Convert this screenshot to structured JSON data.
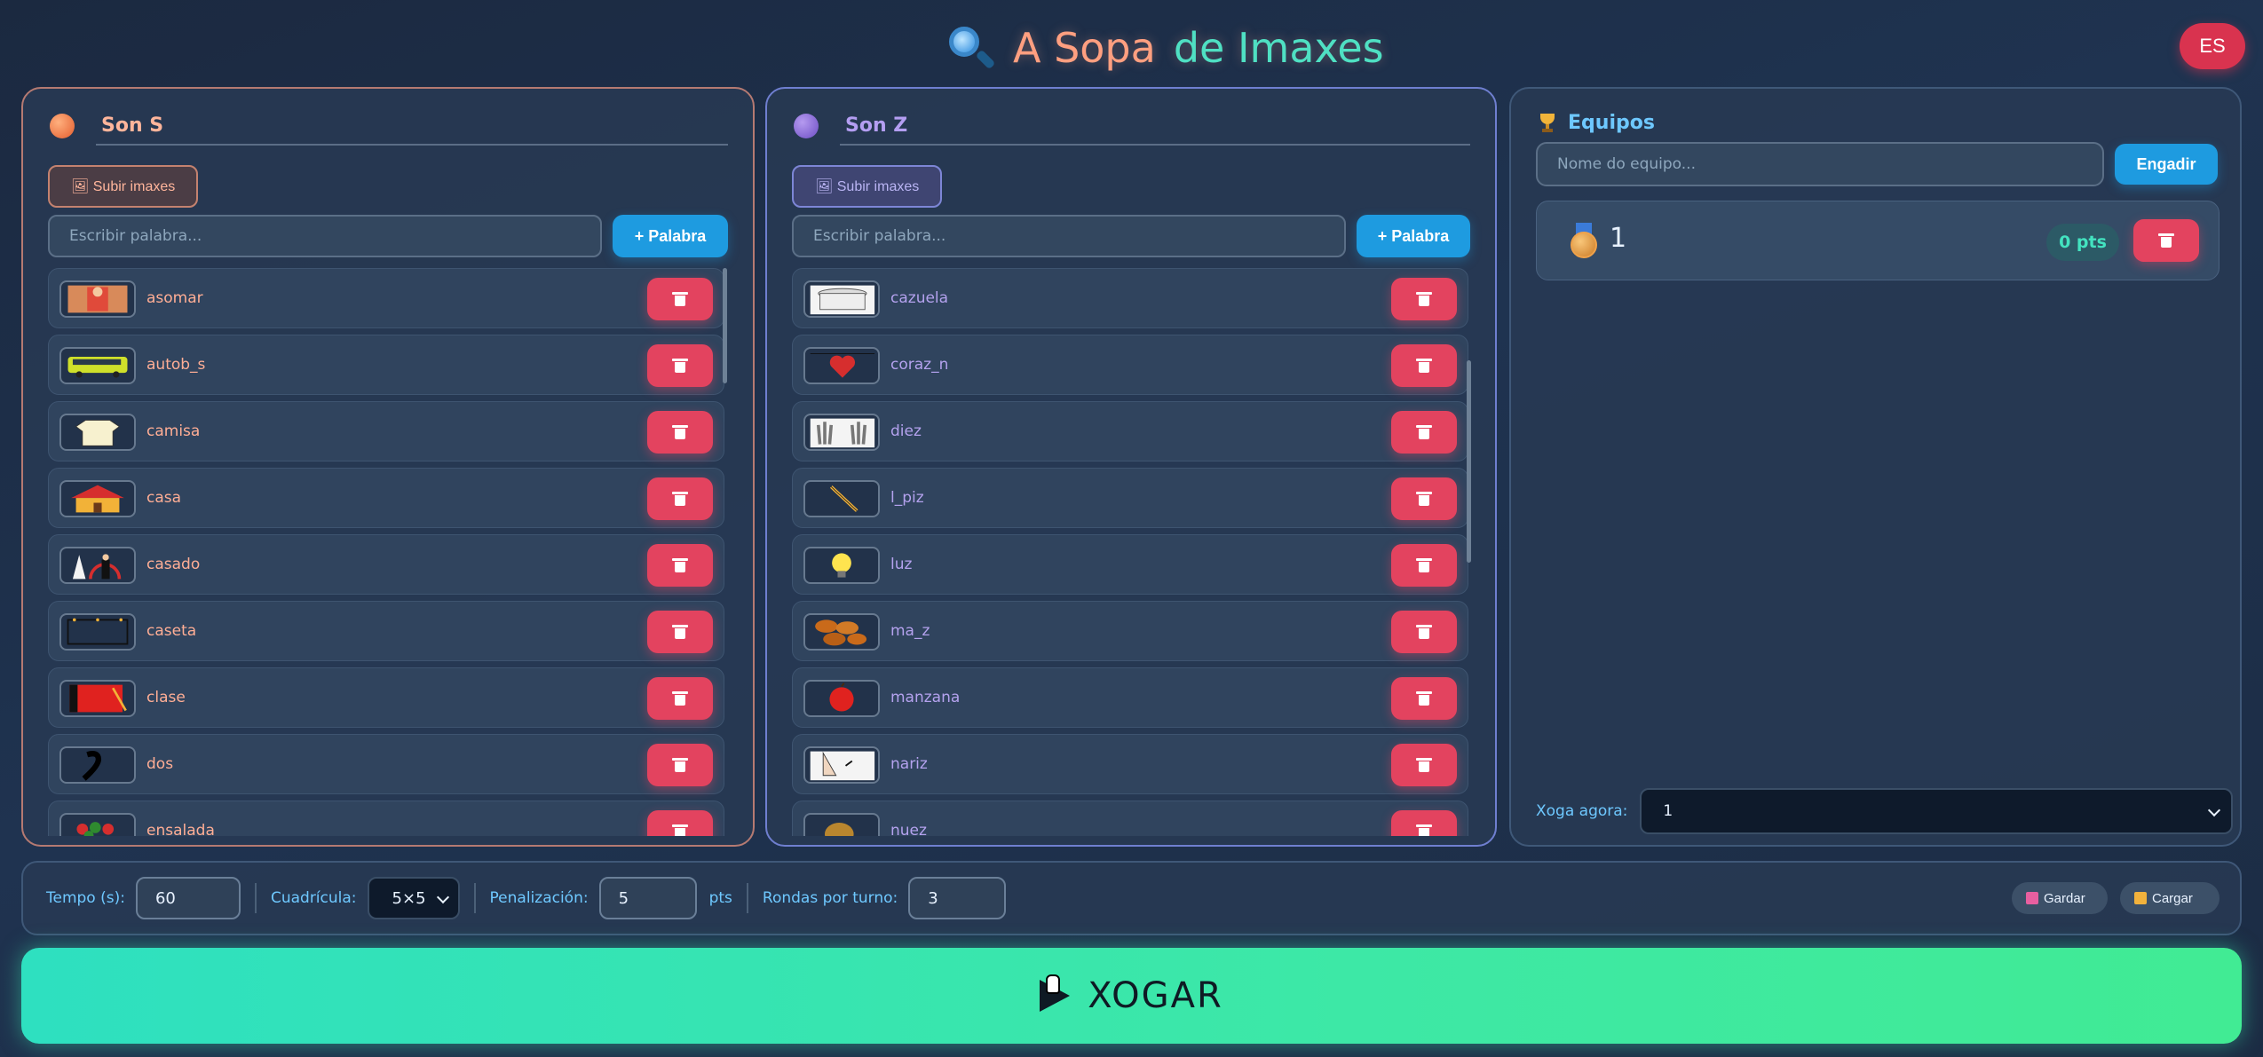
{
  "app": {
    "title_part1": "A Sopa",
    "title_part2": "de Imaxes",
    "lang_button": "ES"
  },
  "icons": {
    "title": "magnifier-icon",
    "upload": "image-icon",
    "delete": "trash-icon",
    "teams": "trophy-icon",
    "medal": "medal-icon",
    "save": "disk-icon",
    "load": "folder-icon",
    "play": "play-icon"
  },
  "colors": {
    "accent_s": "#ff9f80",
    "accent_z": "#b49ef2",
    "primary_blue": "#1e9be0",
    "danger": "#e3435f",
    "play_green": "#3de8a6"
  },
  "panel_s": {
    "name": "Son S",
    "upload_label": "🖼 Subir imaxes",
    "input_placeholder": "Escribir palabra...",
    "add_label": "+ Palabra",
    "items": [
      {
        "label": "asomar",
        "image": "person-window"
      },
      {
        "label": "autob_s",
        "image": "bus"
      },
      {
        "label": "camisa",
        "image": "shirt"
      },
      {
        "label": "casa",
        "image": "house"
      },
      {
        "label": "casado",
        "image": "wedding-couple"
      },
      {
        "label": "caseta",
        "image": "hut"
      },
      {
        "label": "clase",
        "image": "classroom"
      },
      {
        "label": "dos",
        "image": "number-two"
      },
      {
        "label": "ensalada",
        "image": "salad"
      }
    ]
  },
  "panel_z": {
    "name": "Son Z",
    "upload_label": "🖼 Subir imaxes",
    "input_placeholder": "Escribir palabra...",
    "add_label": "+ Palabra",
    "items": [
      {
        "label": "cazuela",
        "image": "pot"
      },
      {
        "label": "coraz_n",
        "image": "heart"
      },
      {
        "label": "diez",
        "image": "hands"
      },
      {
        "label": "l_piz",
        "image": "pencil"
      },
      {
        "label": "luz",
        "image": "light-bulb"
      },
      {
        "label": "ma_z",
        "image": "corn"
      },
      {
        "label": "manzana",
        "image": "apple"
      },
      {
        "label": "nariz",
        "image": "nose"
      },
      {
        "label": "nuez",
        "image": "walnut"
      }
    ]
  },
  "teams": {
    "title": "Equipos",
    "input_placeholder": "Nome do equipo...",
    "add_label": "Engadir",
    "list": [
      {
        "name": "1",
        "points": "0 pts"
      }
    ],
    "playing_label": "Xoga agora:",
    "playing_value": "1"
  },
  "settings": {
    "time_label": "Tempo (s):",
    "time_value": "60",
    "grid_label": "Cuadrícula:",
    "grid_value": "5×5",
    "penalty_label": "Penalización:",
    "penalty_value": "5",
    "penalty_unit": "pts",
    "rounds_label": "Rondas por turno:",
    "rounds_value": "3",
    "save_label": "Gardar",
    "load_label": "Cargar"
  },
  "play": {
    "label": "XOGAR"
  }
}
